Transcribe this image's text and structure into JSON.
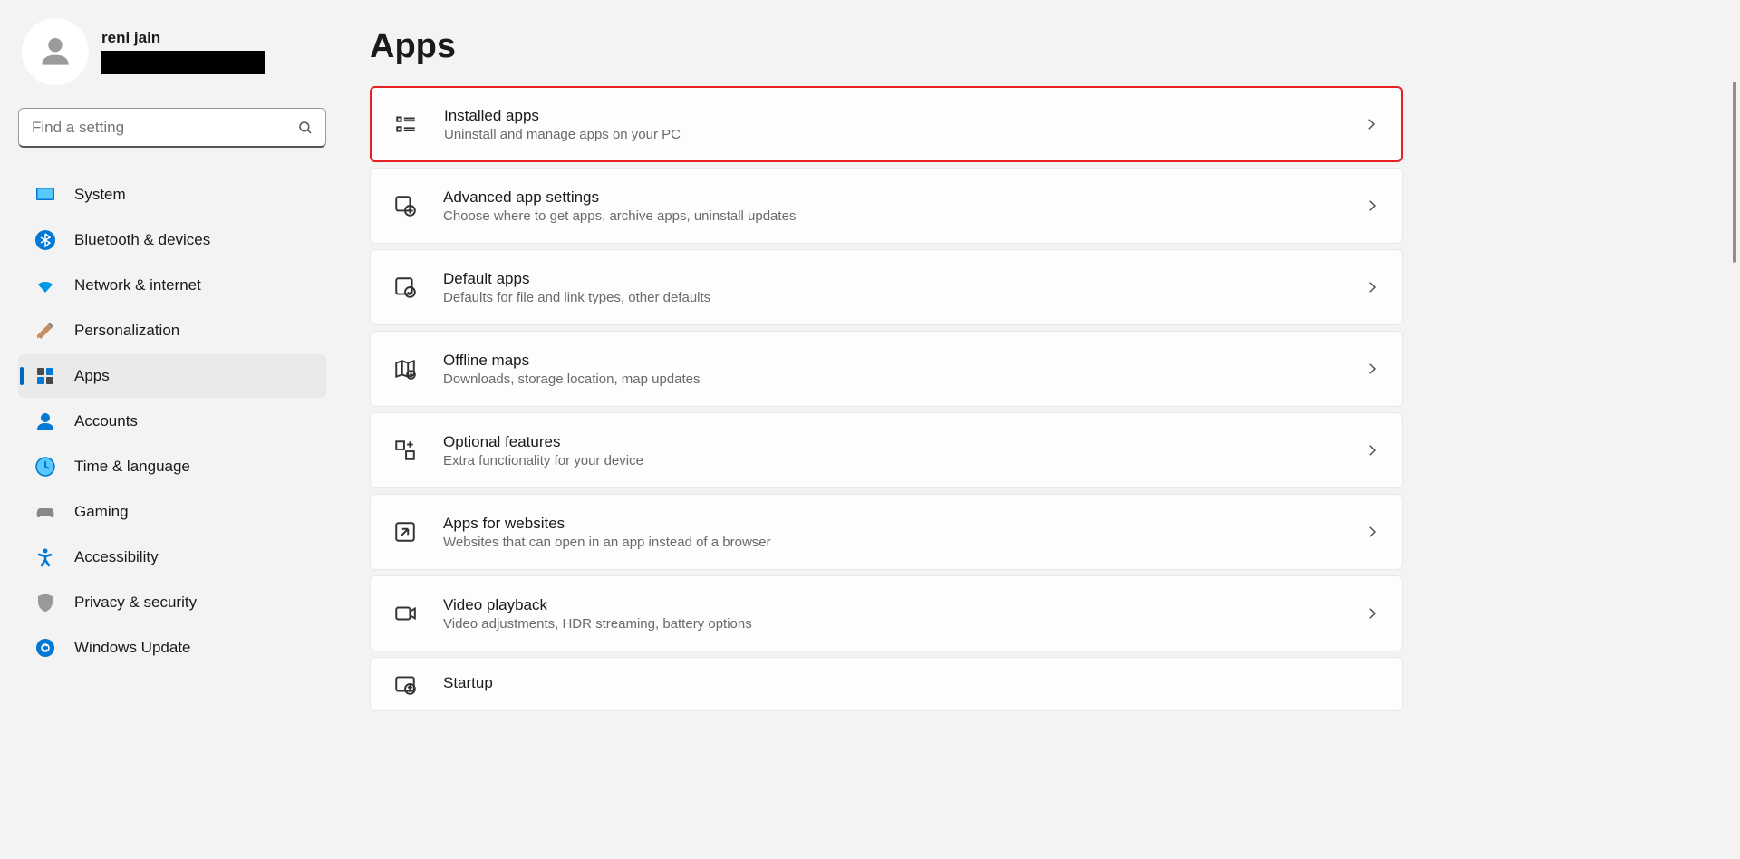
{
  "user": {
    "name": "reni jain"
  },
  "search": {
    "placeholder": "Find a setting"
  },
  "sidebar": {
    "items": [
      {
        "label": "System"
      },
      {
        "label": "Bluetooth & devices"
      },
      {
        "label": "Network & internet"
      },
      {
        "label": "Personalization"
      },
      {
        "label": "Apps"
      },
      {
        "label": "Accounts"
      },
      {
        "label": "Time & language"
      },
      {
        "label": "Gaming"
      },
      {
        "label": "Accessibility"
      },
      {
        "label": "Privacy & security"
      },
      {
        "label": "Windows Update"
      }
    ]
  },
  "page": {
    "title": "Apps"
  },
  "cards": [
    {
      "title": "Installed apps",
      "desc": "Uninstall and manage apps on your PC"
    },
    {
      "title": "Advanced app settings",
      "desc": "Choose where to get apps, archive apps, uninstall updates"
    },
    {
      "title": "Default apps",
      "desc": "Defaults for file and link types, other defaults"
    },
    {
      "title": "Offline maps",
      "desc": "Downloads, storage location, map updates"
    },
    {
      "title": "Optional features",
      "desc": "Extra functionality for your device"
    },
    {
      "title": "Apps for websites",
      "desc": "Websites that can open in an app instead of a browser"
    },
    {
      "title": "Video playback",
      "desc": "Video adjustments, HDR streaming, battery options"
    },
    {
      "title": "Startup",
      "desc": ""
    }
  ]
}
